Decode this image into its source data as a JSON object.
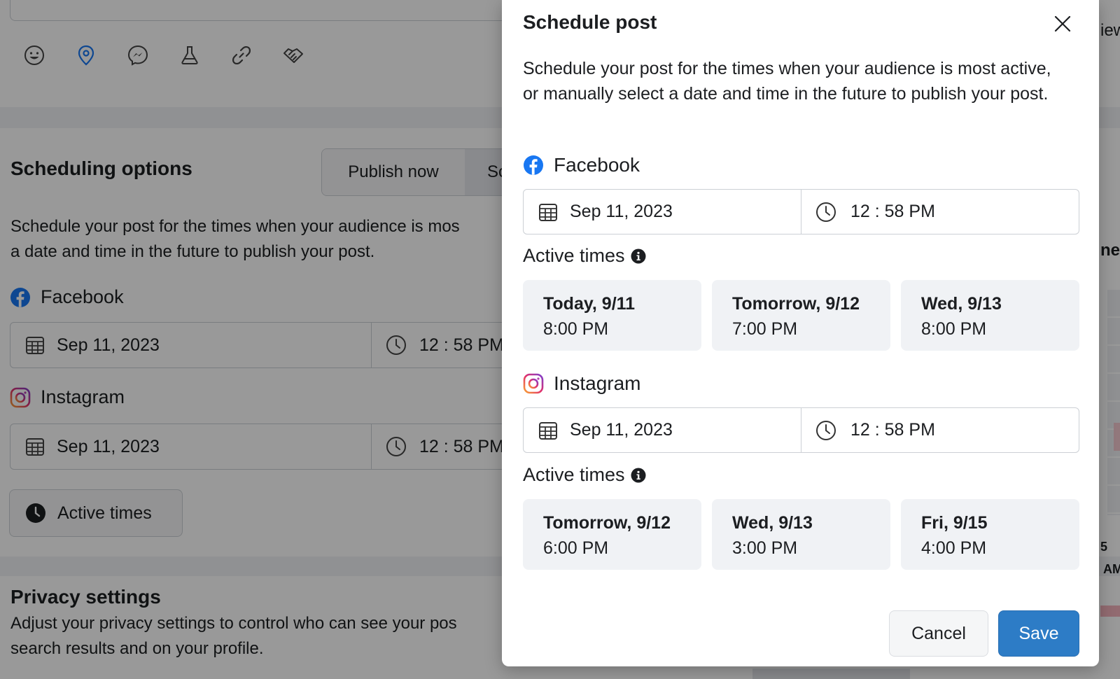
{
  "background": {
    "scheduling_title": "Scheduling options",
    "publish_now": "Publish now",
    "schedule_partial": "Sc",
    "scheduling_desc_line1": "Schedule your post for the times when your audience is mos",
    "scheduling_desc_line2": "a date and time in the future to publish your post.",
    "facebook": {
      "name": "Facebook",
      "date": "Sep 11, 2023",
      "time": "12 : 58 PM"
    },
    "instagram": {
      "name": "Instagram",
      "date": "Sep 11, 2023",
      "time": "12 : 58 PM"
    },
    "active_times_button": "Active times",
    "privacy_title": "Privacy settings",
    "privacy_desc_line1": "Adjust your privacy settings to control who can see your pos",
    "privacy_desc_line2": "search results and on your profile.",
    "right_fragments": [
      "iew",
      "ner",
      "5",
      "AM"
    ]
  },
  "modal": {
    "title": "Schedule post",
    "description": "Schedule your post for the times when your audience is most active, or manually select a date and time in the future to publish your post.",
    "facebook": {
      "name": "Facebook",
      "date": "Sep 11, 2023",
      "time": "12 : 58 PM",
      "active_times_label": "Active times",
      "slots": [
        {
          "day": "Today, 9/11",
          "time": "8:00 PM"
        },
        {
          "day": "Tomorrow, 9/12",
          "time": "7:00 PM"
        },
        {
          "day": "Wed, 9/13",
          "time": "8:00 PM"
        }
      ]
    },
    "instagram": {
      "name": "Instagram",
      "date": "Sep 11, 2023",
      "time": "12 : 58 PM",
      "active_times_label": "Active times",
      "slots": [
        {
          "day": "Tomorrow, 9/12",
          "time": "6:00 PM"
        },
        {
          "day": "Wed, 9/13",
          "time": "3:00 PM"
        },
        {
          "day": "Fri, 9/15",
          "time": "4:00 PM"
        }
      ]
    },
    "cancel_label": "Cancel",
    "save_label": "Save"
  },
  "colors": {
    "facebook_blue": "#1877f2",
    "save_blue": "#2d7cc6",
    "slot_bg": "#f0f2f5"
  },
  "icons": [
    "smiley-icon",
    "location-pin-icon",
    "messenger-icon",
    "flask-icon",
    "link-icon",
    "handshake-icon",
    "calendar-icon",
    "clock-icon",
    "info-icon",
    "close-icon",
    "facebook-icon",
    "instagram-icon"
  ]
}
